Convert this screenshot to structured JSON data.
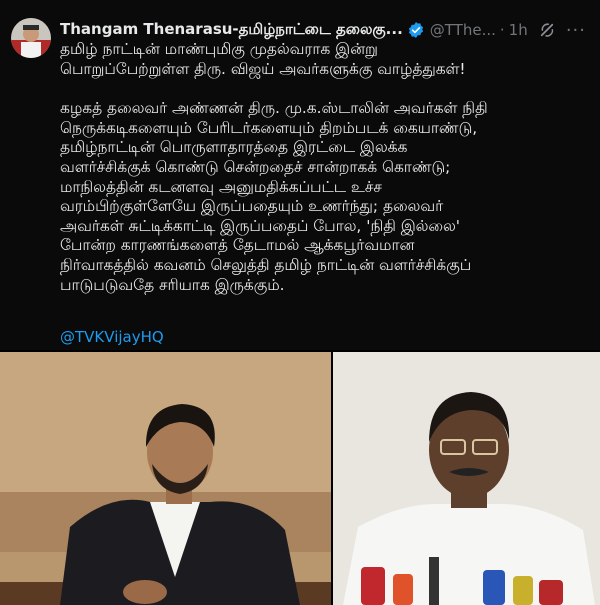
{
  "tweet": {
    "author_name": "Thangam Thenarasu-தமிழ்நாட்டை தலைகு...",
    "handle": "@TThe...",
    "separator": "·",
    "time": "1h",
    "text_lines": [
      "தமிழ் நாட்டின் மாண்புமிகு முதல்வராக இன்று",
      "பொறுப்பேற்றுள்ள திரு. விஜய் அவர்களுக்கு வாழ்த்துகள்!"
    ],
    "text_lines_2": [
      "கழகத் தலைவர் அண்ணன் திரு. மு.க.ஸ்டாலின் அவர்கள் நிதி",
      "நெருக்கடிகளையும் பேரிடர்களையும் திறம்படக் கையாண்டு,",
      "தமிழ்நாட்டின் பொருளாதாரத்தை இரட்டை இலக்க",
      "வளர்ச்சிக்குக் கொண்டு சென்றதைச் சான்றாகக் கொண்டு;",
      "மாநிலத்தின் கடனளவு அனுமதிக்கப்பட்ட உச்ச",
      "வரம்பிற்குள்ளேயே இருப்பதையும் உணர்ந்து; தலைவர்",
      "அவர்கள் சுட்டிக்காட்டி இருப்பதைப் போல, 'நிதி இல்லை'",
      "போன்ற காரணங்களைத் தேடாமல் ஆக்கபூர்வமான",
      "நிர்வாகத்தில் கவனம் செலுத்தி தமிழ் நாட்டின் வளர்ச்சிக்குப்",
      "பாடுபடுவதே சரியாக இருக்கும்."
    ],
    "mention": "@TVKVijayHQ"
  },
  "icons": {
    "verified": "verified-badge-icon",
    "grok": "grok-icon",
    "more": "more-options-icon"
  },
  "colors": {
    "background": "#000000",
    "text": "#e7e9ea",
    "muted": "#71767b",
    "link": "#1d9bf0",
    "verified": "#1d9bf0"
  }
}
